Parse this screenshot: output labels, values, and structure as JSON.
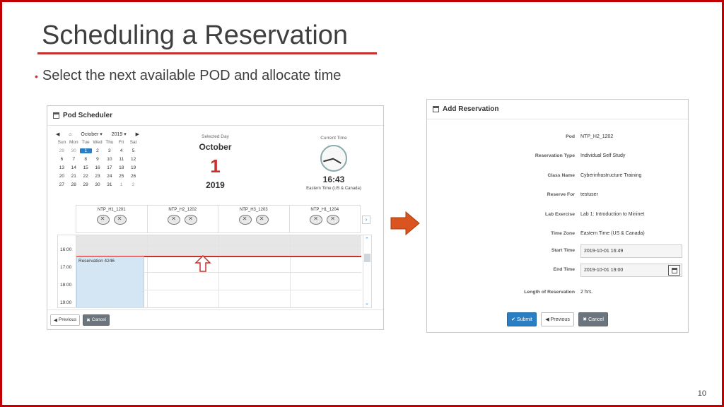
{
  "slide": {
    "title": "Scheduling a Reservation",
    "bullet": "Select the next available POD and allocate time",
    "page_number": "10"
  },
  "colors": {
    "accent_red": "#c8322e",
    "primary_blue": "#2a7ec3",
    "reservation_fill": "#d4e6f3"
  },
  "pod_scheduler": {
    "title": "Pod Scheduler",
    "calendar": {
      "month": "October",
      "year": "2019",
      "weekdays": [
        "Sun",
        "Mon",
        "Tue",
        "Wed",
        "Thu",
        "Fri",
        "Sat"
      ],
      "days": [
        [
          "29",
          "30",
          "1",
          "2",
          "3",
          "4",
          "5"
        ],
        [
          "6",
          "7",
          "8",
          "9",
          "10",
          "11",
          "12"
        ],
        [
          "13",
          "14",
          "15",
          "16",
          "17",
          "18",
          "19"
        ],
        [
          "20",
          "21",
          "22",
          "23",
          "24",
          "25",
          "26"
        ],
        [
          "27",
          "28",
          "29",
          "30",
          "31",
          "1",
          "2"
        ]
      ]
    },
    "selected_day": {
      "label": "Selected Day",
      "month": "October",
      "day": "1",
      "year": "2019"
    },
    "current_time": {
      "label": "Current Time",
      "time": "16:43",
      "zone": "Eastern Time (US & Canada)"
    },
    "pods": [
      "NTP_H1_1201",
      "NTP_H2_1202",
      "NTP_H3_1203",
      "NTP_H1_1204"
    ],
    "times": [
      "16:00",
      "17:00",
      "18:00",
      "19:00"
    ],
    "reservation_label": "Reservation 4246",
    "previous_label": "Previous",
    "cancel_label": "Cancel"
  },
  "add_reservation": {
    "title": "Add Reservation",
    "fields": {
      "pod": {
        "label": "Pod",
        "value": "NTP_H2_1202"
      },
      "type": {
        "label": "Reservation Type",
        "value": "Individual Self Study"
      },
      "class": {
        "label": "Class Name",
        "value": "Cyberinfrastructure Training"
      },
      "for": {
        "label": "Reserve For",
        "value": "testuser"
      },
      "exercise": {
        "label": "Lab Exercise",
        "value": "Lab 1: Introduction to Mininet"
      },
      "zone": {
        "label": "Time Zone",
        "value": "Eastern Time (US & Canada)"
      },
      "start": {
        "label": "Start Time",
        "value": "2019-10-01 16:49"
      },
      "end": {
        "label": "End Time",
        "value": "2019-10-01 19:00"
      },
      "length": {
        "label": "Length of Reservation",
        "value": "2 hrs."
      }
    },
    "submit_label": "Submit",
    "previous_label": "Previous",
    "cancel_label": "Cancel"
  }
}
